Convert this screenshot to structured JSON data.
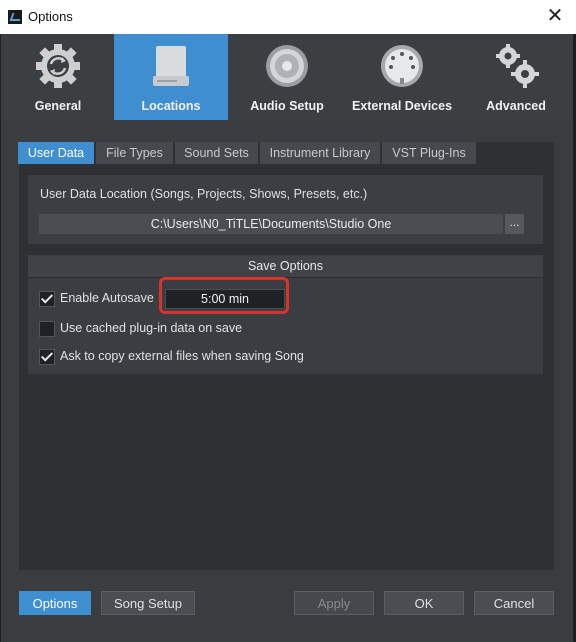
{
  "window": {
    "title": "Options",
    "close_glyph": "✕"
  },
  "toolbar": {
    "items": [
      {
        "label": "General",
        "icon": "gear-refresh-icon",
        "active": false
      },
      {
        "label": "Locations",
        "icon": "drive-icon",
        "active": true
      },
      {
        "label": "Audio Setup",
        "icon": "speaker-icon",
        "active": false
      },
      {
        "label": "External Devices",
        "icon": "midi-connector-icon",
        "active": false
      },
      {
        "label": "Advanced",
        "icon": "gears-icon",
        "active": false
      }
    ]
  },
  "subtabs": [
    {
      "label": "User Data",
      "active": true
    },
    {
      "label": "File Types",
      "active": false
    },
    {
      "label": "Sound Sets",
      "active": false
    },
    {
      "label": "Instrument Library",
      "active": false
    },
    {
      "label": "VST Plug-Ins",
      "active": false
    }
  ],
  "user_data": {
    "location_label": "User Data Location (Songs, Projects, Shows, Presets, etc.)",
    "path_value": "C:\\Users\\N0_TiTLE\\Documents\\Studio One",
    "browse_label": "..."
  },
  "save_options": {
    "title": "Save Options",
    "enable_autosave": {
      "label": "Enable Autosave",
      "checked": true
    },
    "autosave_interval": "5:00 min",
    "use_cached": {
      "label": "Use cached plug-in data on save",
      "checked": false
    },
    "ask_copy": {
      "label": "Ask to copy external files when saving Song",
      "checked": true
    }
  },
  "footer": {
    "options_label": "Options",
    "song_setup_label": "Song Setup",
    "apply_label": "Apply",
    "ok_label": "OK",
    "cancel_label": "Cancel"
  },
  "colors": {
    "accent": "#3e8ed0",
    "highlight": "#d9322a"
  }
}
